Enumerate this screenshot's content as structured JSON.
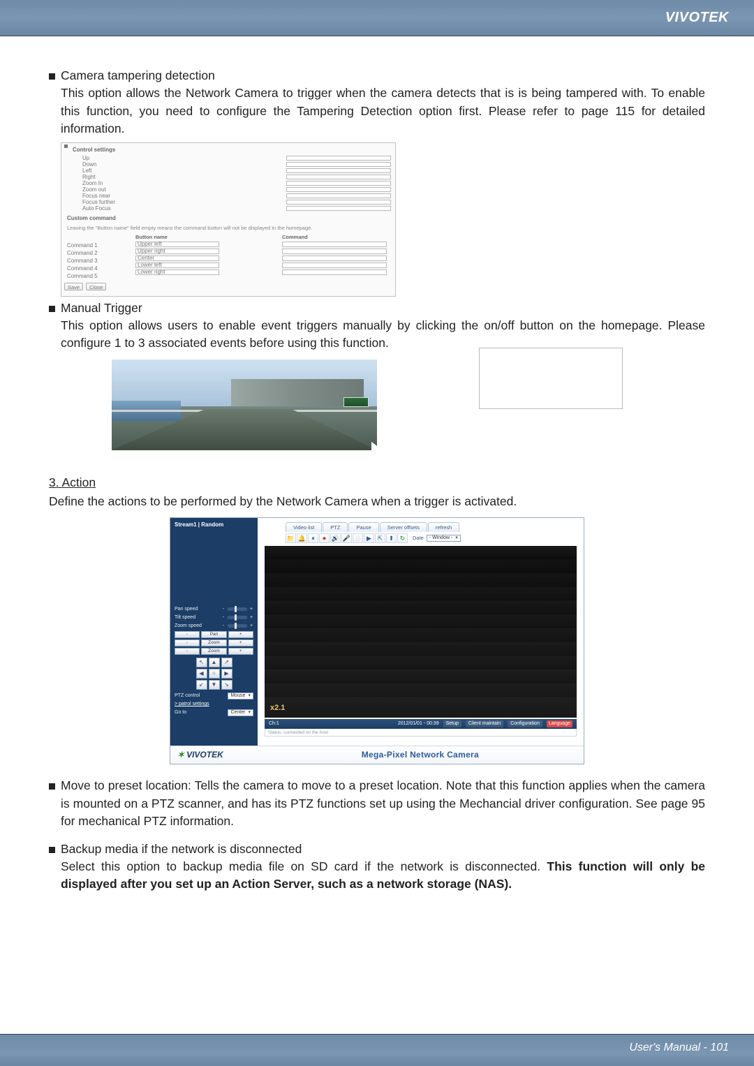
{
  "brand": "VIVOTEK",
  "footer": {
    "label": "User's Manual - ",
    "page": "101"
  },
  "sec1": {
    "title": "Camera tampering detection",
    "body": "This option allows the Network Camera to trigger when the camera detects that is is being tampered with. To enable this function, you need to configure the Tampering Detection option first. Please refer to page 115 for detailed information."
  },
  "control_settings": {
    "title": "Control settings",
    "rows": [
      "Up",
      "Down",
      "Left",
      "Right",
      "Zoom In",
      "Zoom out",
      "Focus near",
      "Focus further",
      "Auto Focus"
    ],
    "custom_title": "Custom command",
    "custom_note": "Leaving the \"Button name\" field empty means the command button will not be displayed in the homepage.",
    "bn_head": "Button name",
    "cmd_head": "Command",
    "labels": [
      "Command 1",
      "Command 2",
      "Command 3",
      "Command 4",
      "Command 5"
    ],
    "bn_vals": [
      "Upper left",
      "Upper right",
      "Center",
      "Lower left",
      "Lower right"
    ],
    "save": "Save",
    "close": "Close"
  },
  "sec2": {
    "title": "Manual Trigger",
    "body": "This option allows users to enable event triggers manually by clicking the on/off button on the homepage. Please configure 1 to 3 associated events before using this function."
  },
  "action": {
    "heading": "3. Action",
    "body": "Define the actions to be performed by the Network Camera when a trigger is activated."
  },
  "camera_ui": {
    "sidebar_header": "Stream1 | Random",
    "pan": "Pan speed",
    "tilt": "Tilt speed",
    "zoom": "Zoom speed",
    "go": "Go to",
    "go_val": "Center",
    "ptz": "PTZ control",
    "ptz_val": "Mouse",
    "btn1": "-",
    "btn2": "Pan",
    "btn3": "+",
    "btn4": "-",
    "btn5": "Zoom",
    "btn6": "+",
    "btn7": "-",
    "btn8": "Zoom",
    "btn9": "+",
    "tabs": [
      "Video list",
      "PTZ",
      "Pause",
      "Server offsets",
      "refresh"
    ],
    "dt_label": "Date",
    "dt_val": "- Window -",
    "zoom_label": "x2.1",
    "status_left": "Ch:1",
    "ts": "2012/01/01 - 00:39",
    "tags": [
      "Setup",
      "Client maintain",
      "Configuration",
      "Language"
    ],
    "sub": "Status: connected on the host",
    "product": "Mega-Pixel Network Camera",
    "logo": "VIVOTEK"
  },
  "sec3": {
    "title": "Move to preset location:",
    "body": " Tells the camera to move to a preset location. Note that this function applies when the camera is mounted on a PTZ scanner, and has its PTZ functions set up using the Mechancial driver configuration. See page 95 for mechanical PTZ information."
  },
  "sec4": {
    "title": "Backup media if the network is disconnected",
    "line1": "Select this option to backup media file on SD card if the network is disconnected. ",
    "bold": "This function will only be displayed after you set up an Action Server, such as a network storage (NAS)."
  }
}
